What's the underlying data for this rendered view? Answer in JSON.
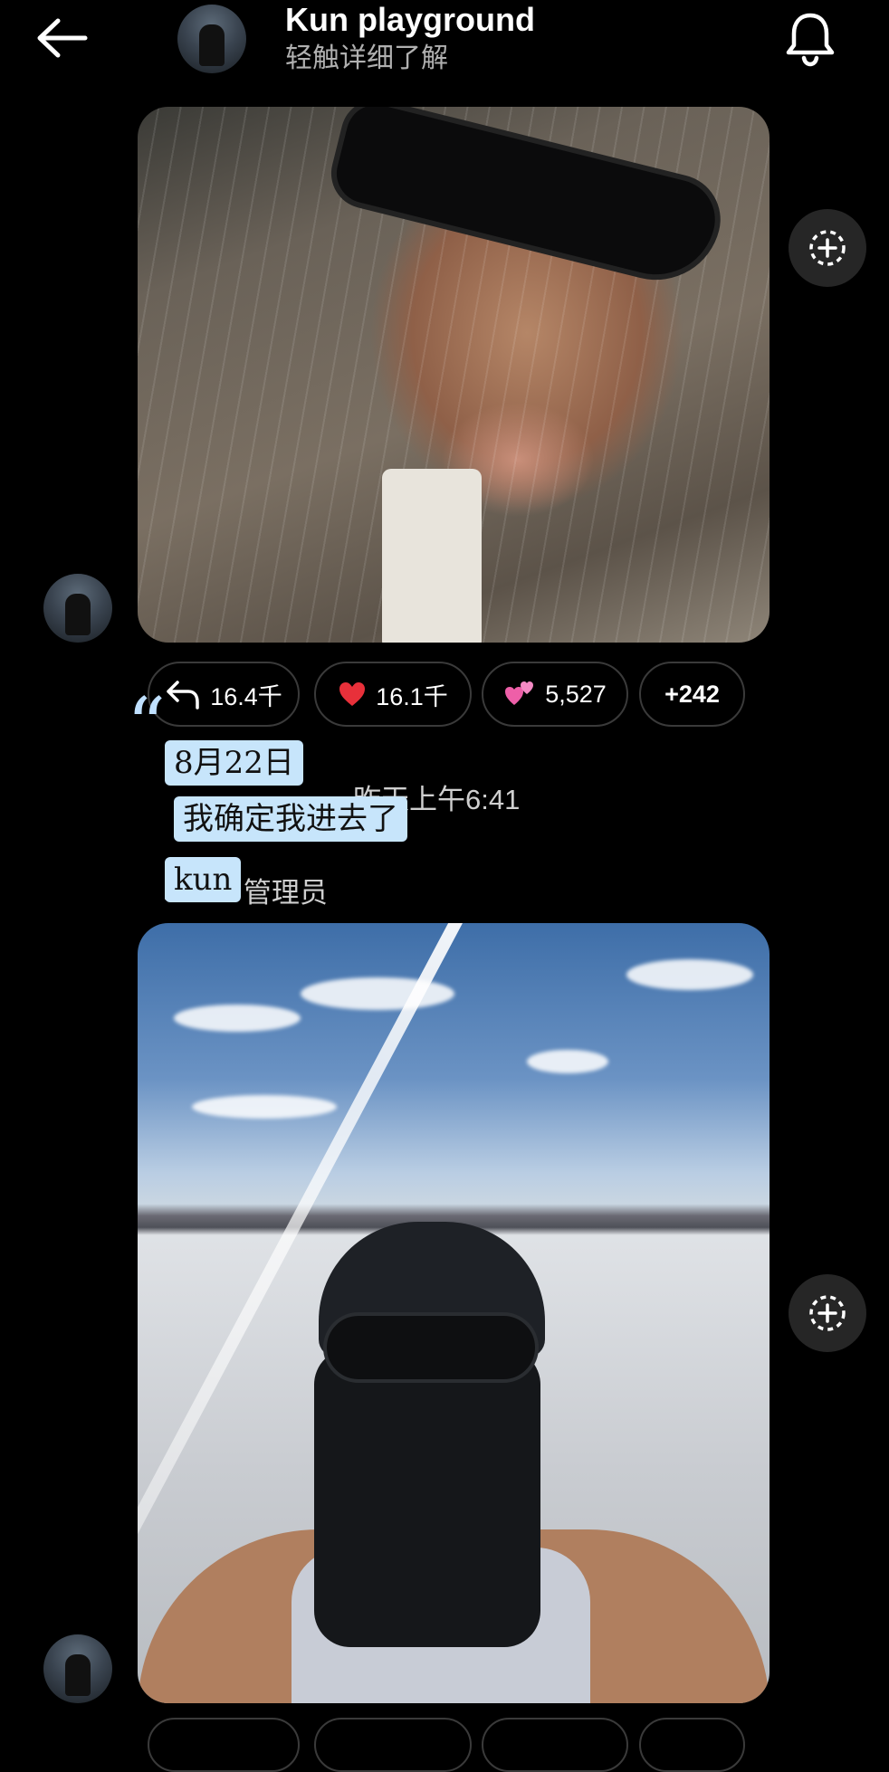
{
  "header": {
    "title": "Kun playground",
    "subtitle": "轻触详细了解"
  },
  "post1": {
    "reactions": [
      {
        "icon": "reply-icon",
        "count": "16.4千"
      },
      {
        "icon": "heart-emoji",
        "count": "16.1千"
      },
      {
        "icon": "two-hearts-emoji",
        "count": "5,527"
      },
      {
        "icon": "",
        "count": "+242"
      }
    ],
    "timestamp": "昨天上午6:41",
    "author": "kun",
    "role": "管理员"
  },
  "overlay": {
    "line1": "8月22日",
    "line2": "我确定我进去了",
    "line3": "kun"
  },
  "colors": {
    "background": "#000000",
    "pill_border": "#3a3a3a",
    "highlight": "#c7e5fb"
  }
}
